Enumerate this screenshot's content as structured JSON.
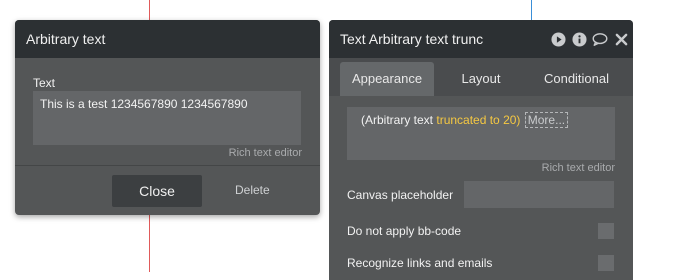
{
  "left_popup": {
    "title": "Arbitrary text",
    "field_label": "Text",
    "field_value": "This is a test 1234567890 1234567890",
    "rich_text_link": "Rich text editor",
    "close_label": "Close",
    "delete_label": "Delete"
  },
  "right_panel": {
    "title": "Text Arbitrary text trunc",
    "header_icons": [
      "play-icon",
      "info-icon",
      "comment-icon",
      "close-icon"
    ],
    "tabs": [
      {
        "label": "Appearance",
        "active": true
      },
      {
        "label": "Layout",
        "active": false
      },
      {
        "label": "Conditional",
        "active": false
      }
    ],
    "expression": {
      "source": "(Arbitrary text",
      "operator": "truncated to 20)",
      "more": "More..."
    },
    "rich_text_link": "Rich text editor",
    "canvas_placeholder_label": "Canvas placeholder",
    "canvas_placeholder_value": "",
    "no_bbcode_label": "Do not apply bb-code",
    "no_bbcode_checked": false,
    "recognize_links_label": "Recognize links and emails",
    "recognize_links_checked": false
  },
  "colors": {
    "panel_bg": "#545657",
    "header_bg": "#2c3033",
    "input_bg": "#646668",
    "operator": "#f5c842",
    "guide_red": "#e05a5a",
    "guide_blue": "#3a8fd8"
  }
}
